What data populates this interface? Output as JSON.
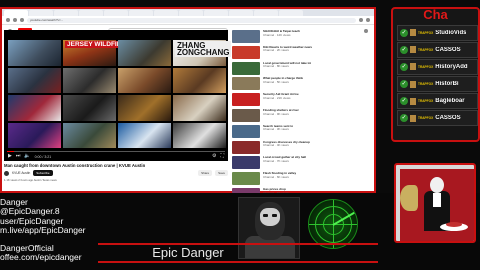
{
  "browser": {
    "url": "youtube.com/watch?v=...",
    "video": {
      "title": "Man caught from downtown Austin construction crane | KVUE Austin",
      "channel": "KVUE Austin",
      "subscribe_label": "Subscribe",
      "share_label": "Share",
      "save_label": "Save",
      "time": "0:00 / 3:21",
      "progress": 0.03,
      "description": "1.1K views  2 hours ago  Austin Texas news",
      "collage_captions": [
        "JERSEY WILDFIRE",
        "ZHANG\nZONGCHANG"
      ]
    },
    "recommendations": [
      {
        "title": "SHANGHAI & Taipei teach",
        "meta": "Channel · 12K views"
      },
      {
        "title": "Kiki Reacts to weird weather news",
        "meta": "Channel · 2K views"
      },
      {
        "title": "Local government will not take lot",
        "meta": "Channel · 8K views"
      },
      {
        "title": "What people in charge think",
        "meta": "Channel · 5K views"
      },
      {
        "title": "Security Aid Grant Arrive",
        "meta": "Channel · 21K views"
      },
      {
        "title": "Flooding shelters at river",
        "meta": "Channel · 9K views"
      },
      {
        "title": "Search teams sent to",
        "meta": "Channel · 3K views"
      },
      {
        "title": "Congress discusses dry cleanup",
        "meta": "Channel · 4K views"
      },
      {
        "title": "Local crowd gather at city hall",
        "meta": "Channel · 7K views"
      },
      {
        "title": "Flash flooding in valley",
        "meta": "Channel · 6K views"
      },
      {
        "title": "Gas prices drop",
        "meta": "Channel · 1K views"
      },
      {
        "title": "Nightly update on events",
        "meta": "Channel · 2K views"
      }
    ]
  },
  "chat": {
    "title": "Cha",
    "messages": [
      {
        "badge": "TRAPFOX",
        "user": "StudioVids"
      },
      {
        "badge": "TRAPFOX",
        "user": "CASSOS"
      },
      {
        "badge": "TRAPFOX",
        "user": "HistoryAdd"
      },
      {
        "badge": "TRAPFOX",
        "user": "HistorBi"
      },
      {
        "badge": "TRAPFOX",
        "user": "Bagleboar"
      },
      {
        "badge": "TRAPFOX",
        "user": "CASSOS"
      }
    ]
  },
  "overlay": {
    "handles": [
      "Danger",
      "@EpicDanger.8",
      "user/EpicDanger",
      "m.live/app/EpicDanger",
      "DangerOfficial",
      "offee.com/epicdanger"
    ],
    "brand": "Epic Danger"
  }
}
